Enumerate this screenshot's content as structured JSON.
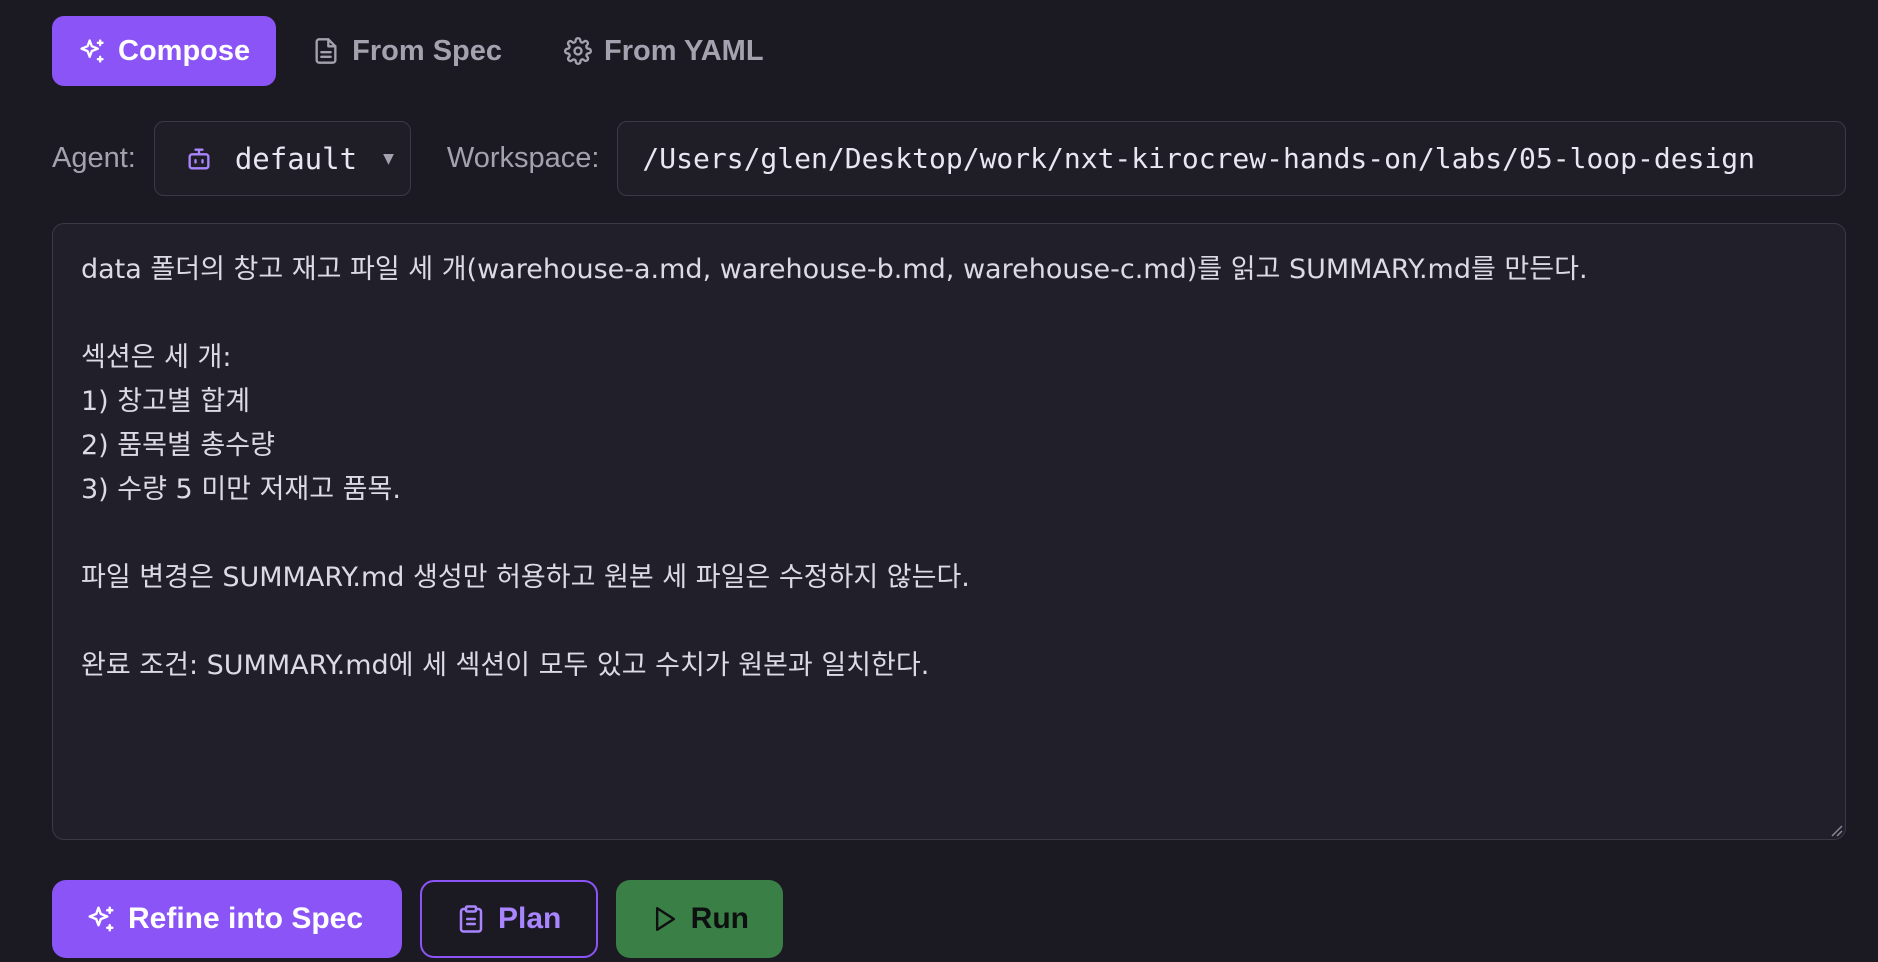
{
  "tabs": {
    "compose": "Compose",
    "from_spec": "From Spec",
    "from_yaml": "From YAML",
    "active": "compose"
  },
  "agent": {
    "label": "Agent:",
    "value": "default"
  },
  "workspace": {
    "label": "Workspace:",
    "value": "/Users/glen/Desktop/work/nxt-kirocrew-hands-on/labs/05-loop-design"
  },
  "prompt": {
    "lines": [
      "data 폴더의 창고 재고 파일 세 개(warehouse-a.md, warehouse-b.md, warehouse-c.md)를 읽고 SUMMARY.md를 만든다.",
      "",
      "섹션은 세 개:",
      "1) 창고별 합계",
      "2) 품목별 총수량",
      "3) 수량 5 미만 저재고 품목.",
      "",
      "파일 변경은 SUMMARY.md 생성만 허용하고 원본 세 파일은 수정하지 않는다.",
      "",
      "완료 조건: SUMMARY.md에 세 섹션이 모두 있고 수치가 원본과 일치한다."
    ]
  },
  "actions": {
    "refine": "Refine into Spec",
    "plan": "Plan",
    "run": "Run"
  },
  "colors": {
    "accent": "#8b54f7",
    "run": "#3a7f45",
    "background": "#1b1a22"
  }
}
